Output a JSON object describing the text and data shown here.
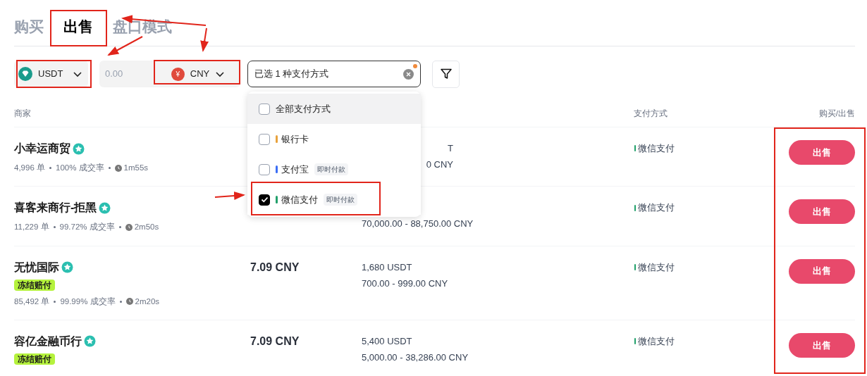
{
  "tabs": [
    {
      "label": "购买",
      "selected": false
    },
    {
      "label": "出售",
      "selected": true
    },
    {
      "label": "盘口模式",
      "selected": false
    }
  ],
  "filters": {
    "crypto": {
      "label": "USDT"
    },
    "amount": {
      "placeholder": "0.00"
    },
    "fiat": {
      "symbol": "¥",
      "label": "CNY"
    },
    "payment": {
      "value": "已选 1 种支付方式",
      "notification_dot": true,
      "open": true
    }
  },
  "payment_options": [
    {
      "label": "全部支付方式",
      "checked": false,
      "selected": true
    },
    {
      "label": "银行卡",
      "checked": false,
      "selected": false,
      "color": "#e8a23c"
    },
    {
      "label": "支付宝",
      "checked": false,
      "selected": false,
      "color": "#3b6ef5",
      "tag": "即时付款"
    },
    {
      "label": "微信支付",
      "checked": true,
      "selected": false,
      "color": "#22a06b",
      "tag": "即时付款"
    }
  ],
  "columns": [
    {
      "kind": "merchant",
      "label": "商家"
    },
    {
      "kind": "payment",
      "label": "支付方式"
    },
    {
      "kind": "action",
      "label": "购买/出售"
    }
  ],
  "rows": [
    {
      "kind": "clipped",
      "merchant": "小幸运商贸",
      "verified": true,
      "stats": [
        "4,996 单",
        "100% 成交率"
      ],
      "time": "1m55s",
      "amount_tail": "T",
      "limits_tail": "0 CNY",
      "payment": {
        "label": "微信支付",
        "color": "#22a06b"
      },
      "action": "出售"
    },
    {
      "kind": "full",
      "merchant": "喜客来商行-拒黑",
      "verified": true,
      "stats": [
        "11,229 单",
        "99.72% 成交率"
      ],
      "time": "2m50s",
      "limits": "70,000.00 - 88,750.00 CNY",
      "payment": {
        "label": "微信支付",
        "color": "#22a06b"
      },
      "action": "出售"
    },
    {
      "kind": "full",
      "merchant": "无忧国际",
      "verified": true,
      "badge": "冻结赔付",
      "stats": [
        "85,492 单",
        "99.99% 成交率"
      ],
      "time": "2m20s",
      "price": "7.09 CNY",
      "amount": "1,680 USDT",
      "limits": "700.00 - 999.00 CNY",
      "payment": {
        "label": "微信支付",
        "color": "#22a06b"
      },
      "action": "出售"
    },
    {
      "kind": "full",
      "merchant": "容亿金融币行",
      "verified": true,
      "badge": "冻结赔付",
      "price": "7.09 CNY",
      "amount": "5,400 USDT",
      "limits": "5,000.00 - 38,286.00 CNY",
      "payment": {
        "label": "微信支付",
        "color": "#22a06b"
      },
      "action": "出售"
    }
  ]
}
